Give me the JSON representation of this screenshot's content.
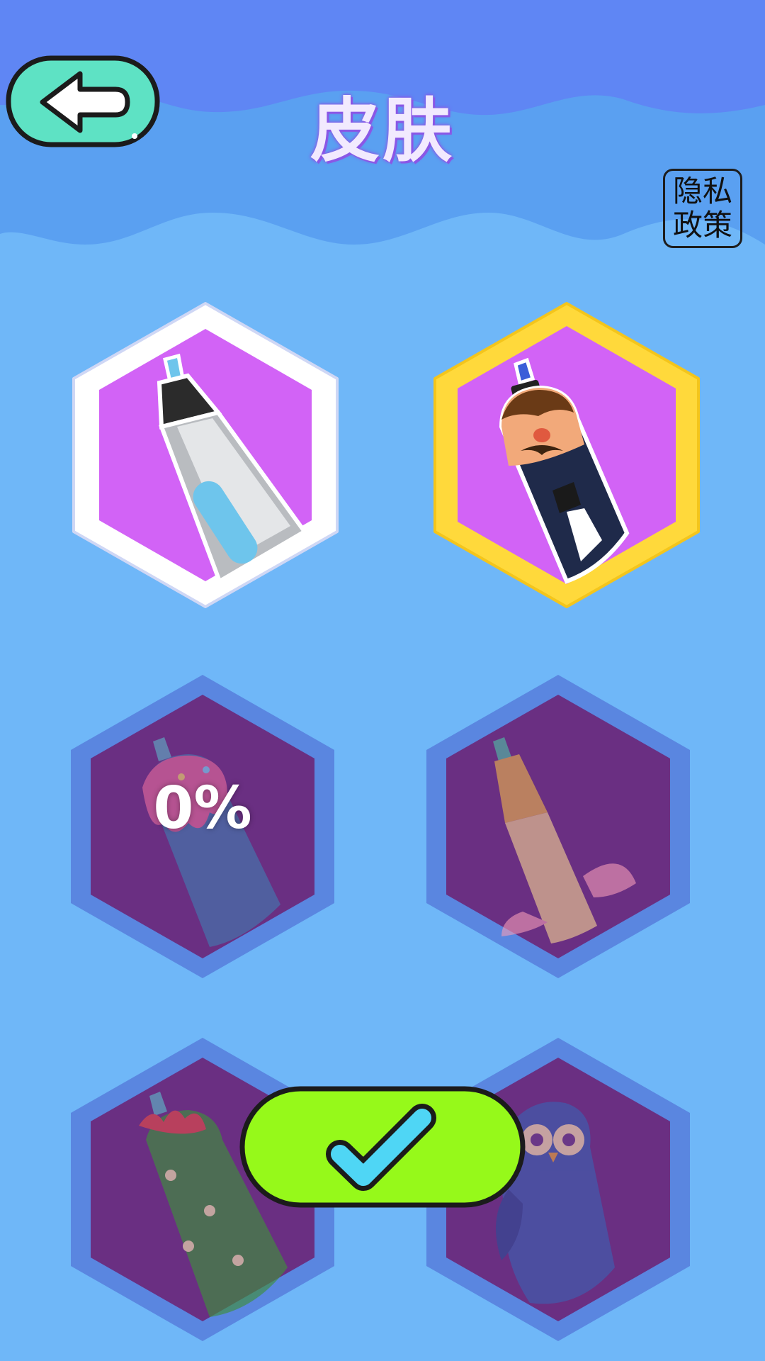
{
  "header": {
    "title": "皮肤",
    "back_icon": "back-arrow-icon",
    "privacy_link_lines": [
      "隐私",
      "政策"
    ]
  },
  "skins": [
    {
      "icon": "classic-pen-skin-icon",
      "state": "unlocked",
      "selected": false
    },
    {
      "icon": "gentleman-pen-skin-icon",
      "state": "unlocked",
      "selected": true
    },
    {
      "icon": "ice-cream-pen-skin-icon",
      "state": "locked",
      "progress": "0%"
    },
    {
      "icon": "unicorn-pen-skin-icon",
      "state": "locked"
    },
    {
      "icon": "cactus-pen-skin-icon",
      "state": "locked"
    },
    {
      "icon": "owl-pen-skin-icon",
      "state": "locked"
    }
  ],
  "confirm_button": {
    "icon": "checkmark-icon"
  },
  "colors": {
    "background": "#6fb7f8",
    "header_band": "#5f86f4",
    "hex_unlocked": "#d263f6",
    "hex_locked": "#6a2f82",
    "selected_border": "#ffd93b",
    "back_button": "#5ee2c4",
    "confirm_button": "#96f91a"
  }
}
